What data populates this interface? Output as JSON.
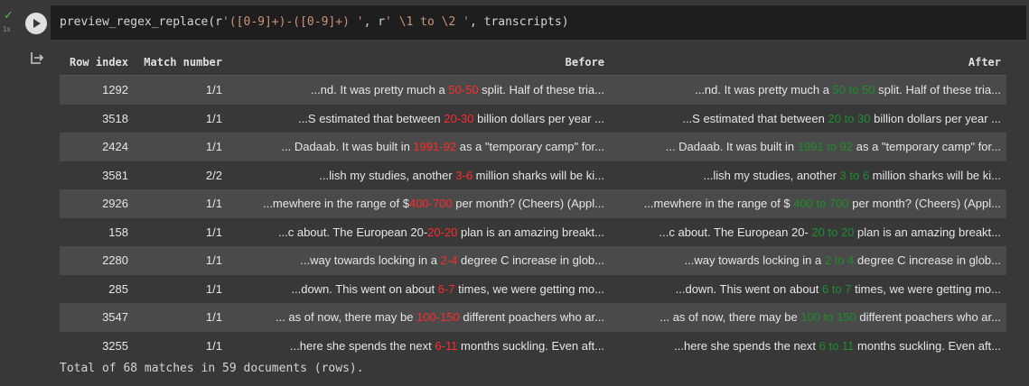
{
  "cell": {
    "exec_time": "1s",
    "code_prefix": "preview_regex_replace(r",
    "code_str1": "'([0-9]+)-([0-9]+) '",
    "code_mid": ", r",
    "code_str2": "' \\1 to \\2 '",
    "code_suffix": ", transcripts)"
  },
  "table": {
    "headers": [
      "Row index",
      "Match number",
      "Before",
      "After"
    ],
    "rows": [
      {
        "row_index": "1292",
        "match": "1/1",
        "before_pre": "...nd. It was pretty much a ",
        "before_hl": "50-50",
        "before_post": " split. Half of these tria...",
        "after_pre": "...nd. It was pretty much a ",
        "after_hl": "50 to 50",
        "after_post": " split. Half of these tria..."
      },
      {
        "row_index": "3518",
        "match": "1/1",
        "before_pre": "...S estimated that between ",
        "before_hl": "20-30",
        "before_post": " billion dollars per year ...",
        "after_pre": "...S estimated that between ",
        "after_hl": "20 to 30",
        "after_post": " billion dollars per year ..."
      },
      {
        "row_index": "2424",
        "match": "1/1",
        "before_pre": "... Dadaab. It was built in ",
        "before_hl": "1991-92",
        "before_post": " as a \"temporary camp\" for...",
        "after_pre": "... Dadaab. It was built in ",
        "after_hl": "1991 to 92",
        "after_post": " as a \"temporary camp\" for..."
      },
      {
        "row_index": "3581",
        "match": "2/2",
        "before_pre": "...lish my studies, another ",
        "before_hl": "3-6",
        "before_post": " million sharks will be ki...",
        "after_pre": "...lish my studies, another ",
        "after_hl": "3 to 6",
        "after_post": " million sharks will be ki..."
      },
      {
        "row_index": "2926",
        "match": "1/1",
        "before_pre": "...mewhere in the range of $",
        "before_hl": "400-700",
        "before_post": " per month? (Cheers) (Appl...",
        "after_pre": "...mewhere in the range of $",
        "after_hl": " 400 to 700",
        "after_post": " per month? (Cheers) (Appl..."
      },
      {
        "row_index": "158",
        "match": "1/1",
        "before_pre": "...c about. The European 20-",
        "before_hl": "20-20",
        "before_post": " plan is an amazing breakt...",
        "after_pre": "...c about. The European 20-",
        "after_hl": " 20 to 20",
        "after_post": " plan is an amazing breakt..."
      },
      {
        "row_index": "2280",
        "match": "1/1",
        "before_pre": "...way towards locking in a ",
        "before_hl": "2-4",
        "before_post": " degree C increase in glob...",
        "after_pre": "...way towards locking in a ",
        "after_hl": "2 to 4",
        "after_post": " degree C increase in glob..."
      },
      {
        "row_index": "285",
        "match": "1/1",
        "before_pre": "...down. This went on about ",
        "before_hl": "6-7",
        "before_post": " times, we were getting mo...",
        "after_pre": "...down. This went on about ",
        "after_hl": "6 to 7",
        "after_post": " times, we were getting mo..."
      },
      {
        "row_index": "3547",
        "match": "1/1",
        "before_pre": "... as of now, there may be ",
        "before_hl": "100-150",
        "before_post": " different poachers who ar...",
        "after_pre": "... as of now, there may be ",
        "after_hl": "100 to 150",
        "after_post": " different poachers who ar..."
      },
      {
        "row_index": "3255",
        "match": "1/1",
        "before_pre": "...here she spends the next ",
        "before_hl": "6-11",
        "before_post": " months suckling. Even aft...",
        "after_pre": "...here she spends the next ",
        "after_hl": "6 to 11",
        "after_post": " months suckling. Even aft..."
      }
    ]
  },
  "footer": {
    "total": "Total of 68 matches in 59 documents (rows)."
  },
  "colors": {
    "before_highlight": "#ff2b2b",
    "after_highlight": "#1e8e2e",
    "check": "#5cb85c"
  }
}
